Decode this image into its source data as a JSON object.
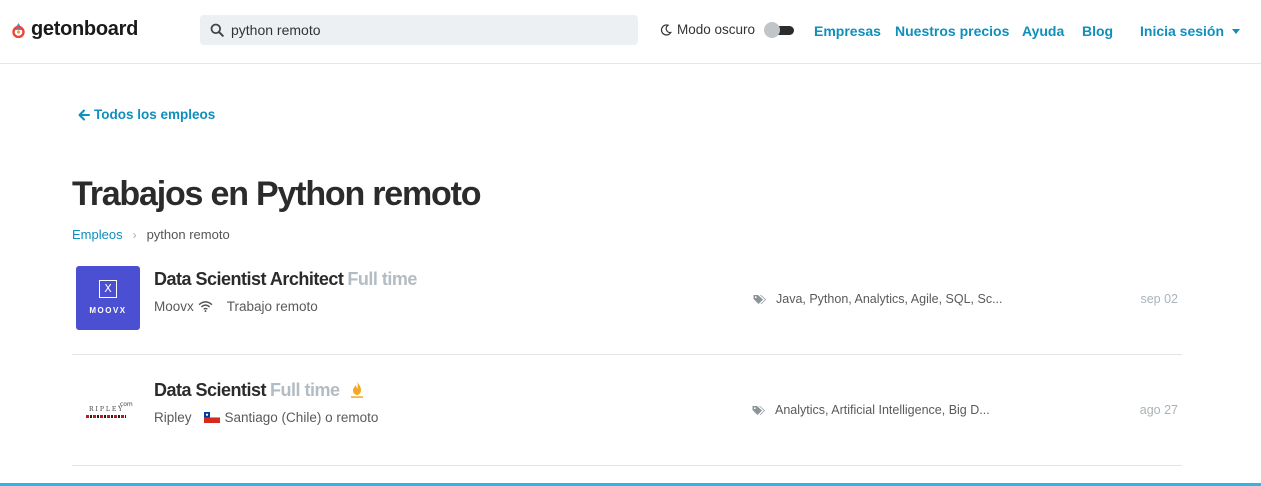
{
  "header": {
    "brand": "getonboard",
    "search": {
      "value": "python remoto",
      "placeholder": ""
    },
    "dark_mode_label": "Modo oscuro",
    "nav": [
      "Empresas",
      "Nuestros precios",
      "Ayuda",
      "Blog"
    ],
    "login_label": "Inicia sesión"
  },
  "back_link": "Todos los empleos",
  "page_title": "Trabajos en Python remoto",
  "breadcrumb": {
    "root": "Empleos",
    "separator": "›",
    "current": "python remoto"
  },
  "jobs": [
    {
      "title": "Data Scientist Architect",
      "type": "Full time",
      "company": "Moovx",
      "location": "Trabajo remoto",
      "tags": "Java, Python, Analytics, Agile, SQL, Sc...",
      "date": "sep 02",
      "logo_text": "MOOVX",
      "logo_mark": "X",
      "logo_color": "#4b4fd1"
    },
    {
      "title": "Data Scientist",
      "type": "Full time",
      "company": "Ripley",
      "location": "Santiago (Chile) o remoto",
      "tags": "Analytics, Artificial Intelligence, Big D...",
      "date": "ago 27",
      "logo_text": "RIPLEY",
      "logo_suffix": ".com"
    }
  ],
  "colors": {
    "accent": "#0e8fbc",
    "muted": "#b3bcc2",
    "hot": "#f5a623",
    "bottom_bar": "#2cb6e6"
  }
}
